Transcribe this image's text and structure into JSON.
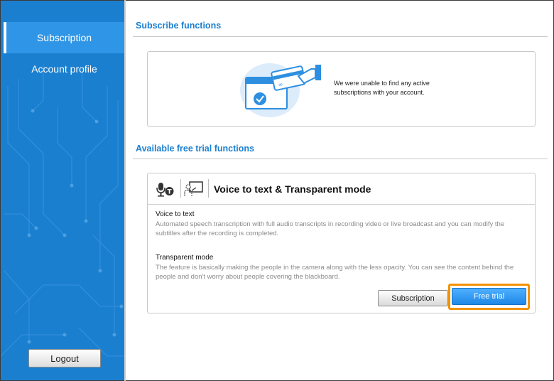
{
  "sidebar": {
    "items": [
      {
        "label": "Subscription",
        "active": true
      },
      {
        "label": "Account profile",
        "active": false
      }
    ],
    "logout_label": "Logout"
  },
  "subscribe": {
    "title": "Subscribe functions",
    "message": "We were unable to find any active subscriptions with your account."
  },
  "trial": {
    "title": "Available free trial functions",
    "card_title": "Voice to text & Transparent mode",
    "features": [
      {
        "name": "Voice to text",
        "description": "Automated speech transcription with full audio transcripts in recording video or live broadcast and you can modify the subtitles after the recording is completed."
      },
      {
        "name": "Transparent mode",
        "description": "The feature is basically making the people in the camera along with the less opacity. You can see the content behind the people and don't worry about people covering the blackboard."
      }
    ],
    "subscription_button": "Subscription",
    "free_trial_button": "Free trial",
    "header_icons": [
      "microphone-text-icon",
      "transparent-presenter-icon"
    ]
  },
  "colors": {
    "sidebar_bg": "#1b7fd0",
    "accent": "#1b7fd0",
    "highlight": "#f39200"
  }
}
